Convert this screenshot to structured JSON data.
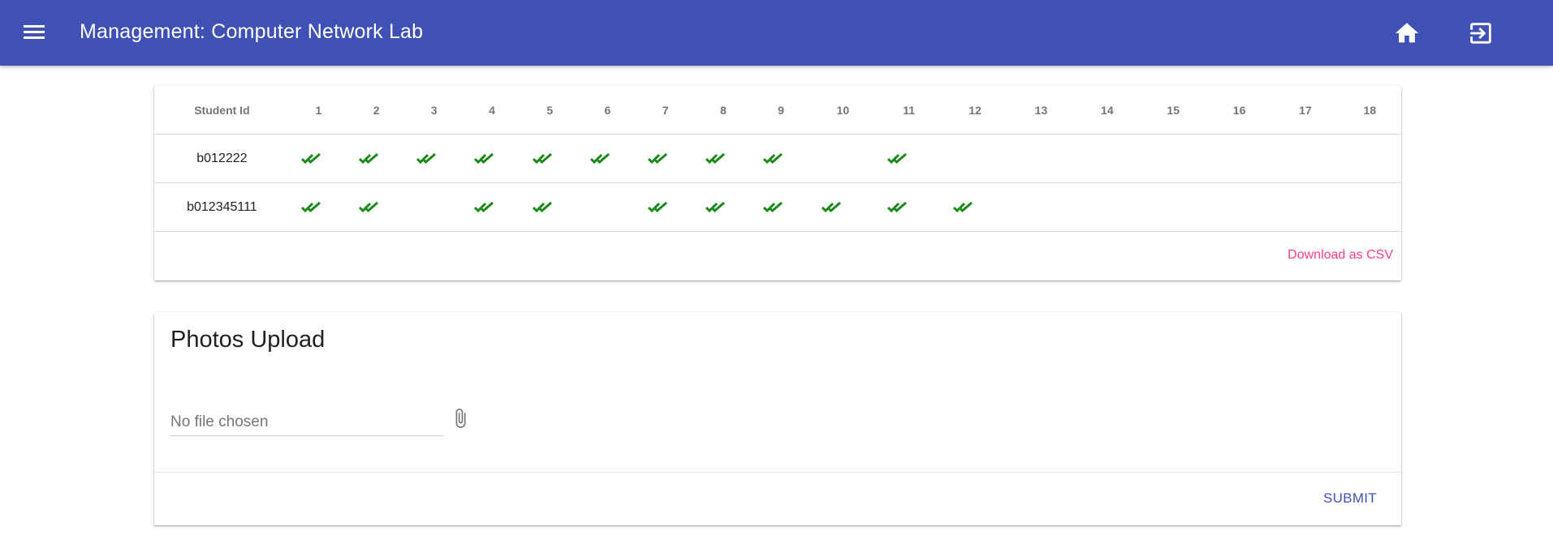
{
  "header": {
    "title": "Management: Computer Network Lab",
    "menu_icon": "menu-icon",
    "home_icon": "home-icon",
    "logout_icon": "exit-icon"
  },
  "attendance": {
    "columns": [
      "Student Id",
      "1",
      "2",
      "3",
      "4",
      "5",
      "6",
      "7",
      "8",
      "9",
      "10",
      "11",
      "12",
      "13",
      "14",
      "15",
      "16",
      "17",
      "18"
    ],
    "rows": [
      {
        "student_id": "b012222",
        "present": [
          true,
          true,
          true,
          true,
          true,
          true,
          true,
          true,
          true,
          false,
          true,
          false,
          false,
          false,
          false,
          false,
          false,
          false
        ]
      },
      {
        "student_id": "b012345111",
        "present": [
          true,
          true,
          false,
          true,
          true,
          false,
          true,
          true,
          true,
          true,
          true,
          true,
          false,
          false,
          false,
          false,
          false,
          false
        ]
      }
    ],
    "check_icon": "double-check-icon",
    "check_color": "#1a8a1a",
    "download_label": "Download as CSV"
  },
  "upload": {
    "title": "Photos Upload",
    "file_placeholder": "No file chosen",
    "attach_icon": "paperclip-icon",
    "submit_label": "SUBMIT"
  },
  "colors": {
    "primary": "#3f51b5",
    "accent": "#ff4081"
  }
}
